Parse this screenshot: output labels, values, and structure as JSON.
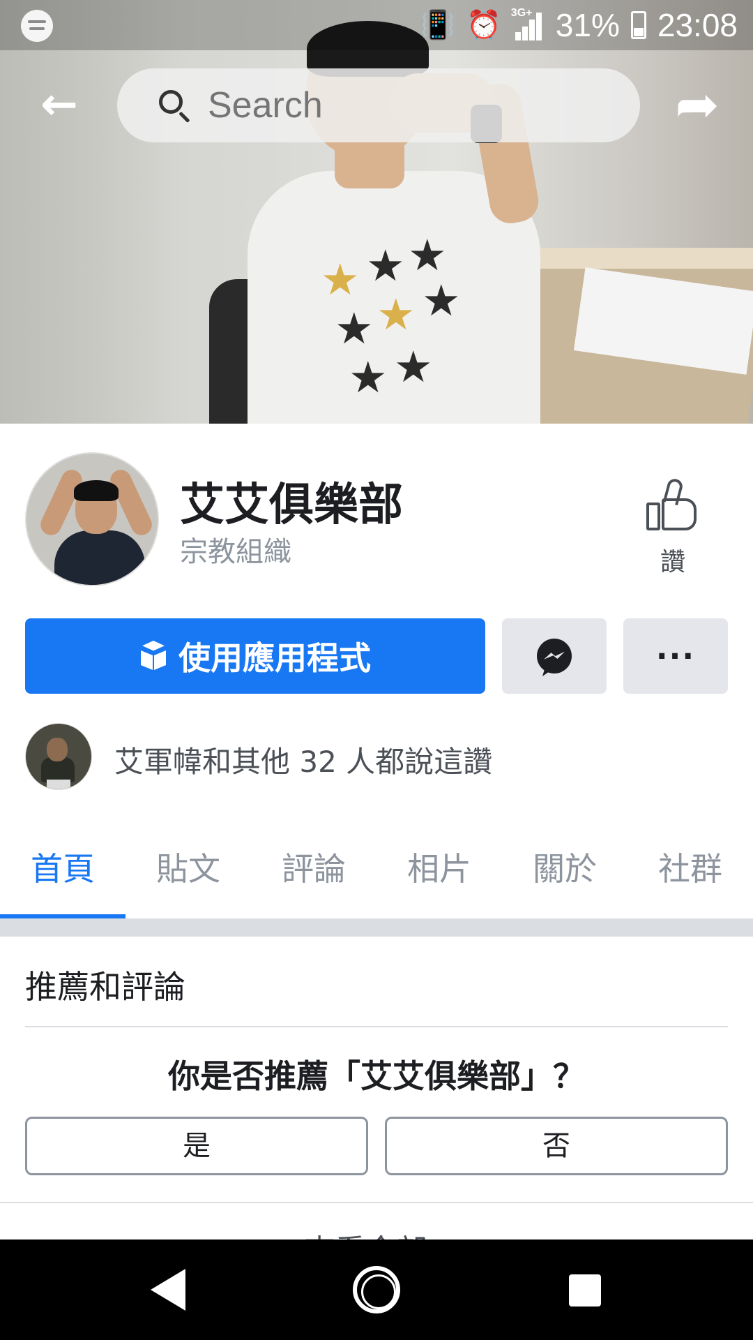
{
  "status_bar": {
    "battery": "31%",
    "time": "23:08",
    "network": "3G+"
  },
  "header": {
    "search_placeholder": "Search"
  },
  "page": {
    "name": "艾艾俱樂部",
    "category": "宗教組織",
    "like_label": "讚"
  },
  "actions": {
    "primary_label": "使用應用程式",
    "more_label": "···"
  },
  "liked_by": {
    "text": "艾軍幃和其他 32 人都說這讚"
  },
  "tabs": [
    {
      "label": "首頁",
      "active": true
    },
    {
      "label": "貼文",
      "active": false
    },
    {
      "label": "評論",
      "active": false
    },
    {
      "label": "相片",
      "active": false
    },
    {
      "label": "關於",
      "active": false
    },
    {
      "label": "社群",
      "active": false
    }
  ],
  "recommendations": {
    "title": "推薦和評論",
    "question": "你是否推薦「艾艾俱樂部」？",
    "yes_label": "是",
    "no_label": "否",
    "see_all": "查看全部 ›"
  },
  "colors": {
    "accent": "#1877f2",
    "secondary_button": "#e4e6eb"
  }
}
